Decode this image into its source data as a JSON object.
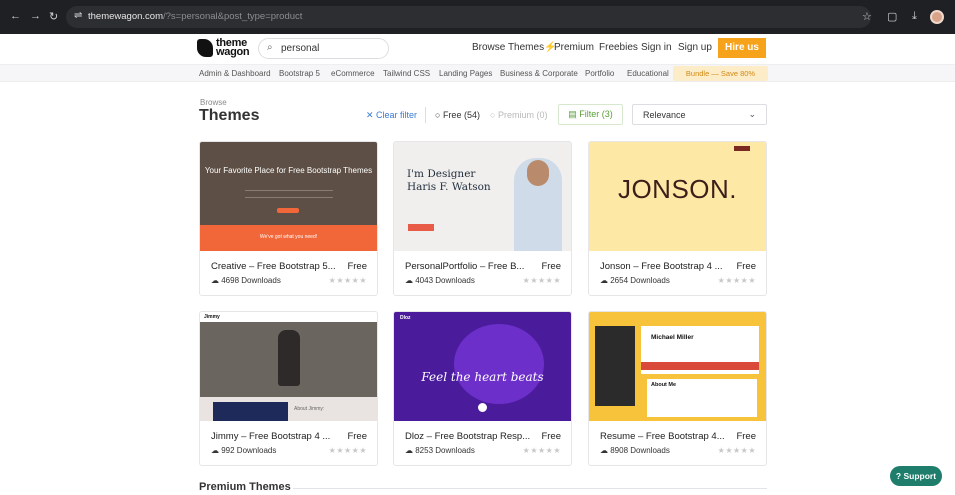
{
  "browser": {
    "url_host": "themewagon.com",
    "url_path": "/?s=personal&post_type=product"
  },
  "header": {
    "logo_line1": "theme",
    "logo_line2": "wagon",
    "search_value": "personal",
    "nav": [
      "Browse Themes",
      "Premium",
      "Freebies",
      "Sign in",
      "Sign up"
    ],
    "hire": "Hire us"
  },
  "categories": [
    "Admin & Dashboard",
    "Bootstrap 5",
    "eCommerce",
    "Tailwind CSS",
    "Landing Pages",
    "Business & Corporate",
    "Portfolio",
    "Educational"
  ],
  "bundle": "Bundle — Save 80%",
  "filters": {
    "browse_label": "Browse",
    "title": "Themes",
    "clear": "Clear filter",
    "free": "Free (54)",
    "premium": "Premium (0)",
    "filter": "Filter (3)",
    "sort": "Relevance"
  },
  "cards": [
    {
      "title": "Creative – Free Bootstrap 5...",
      "price": "Free",
      "downloads": "4698 Downloads",
      "thumb_heading": "Your Favorite Place for Free Bootstrap Themes",
      "thumb_bar": "We've got what you need!"
    },
    {
      "title": "PersonalPortfolio – Free B...",
      "price": "Free",
      "downloads": "4043 Downloads",
      "thumb_heading": "I'm Designer Haris F. Watson"
    },
    {
      "title": "Jonson – Free Bootstrap 4 ...",
      "price": "Free",
      "downloads": "2654 Downloads",
      "thumb_heading": "JONSON."
    },
    {
      "title": "Jimmy – Free Bootstrap 4 ...",
      "price": "Free",
      "downloads": "992 Downloads",
      "thumb_heading": "Jimmy",
      "thumb_sub": "About Jimmy:"
    },
    {
      "title": "Dloz – Free Bootstrap Resp...",
      "price": "Free",
      "downloads": "8253 Downloads",
      "thumb_heading": "Feel the heart beats",
      "thumb_logo": "Dloz"
    },
    {
      "title": "Resume – Free Bootstrap 4...",
      "price": "Free",
      "downloads": "8908 Downloads",
      "thumb_heading": "Michael Miller",
      "thumb_sub": "About Me"
    }
  ],
  "premium_section": "Premium Themes",
  "support": "Support",
  "colors": {
    "accent": "#f7a21b",
    "link": "#3a7bd5",
    "filter": "#5a9e3a",
    "support": "#1e7d6b"
  }
}
